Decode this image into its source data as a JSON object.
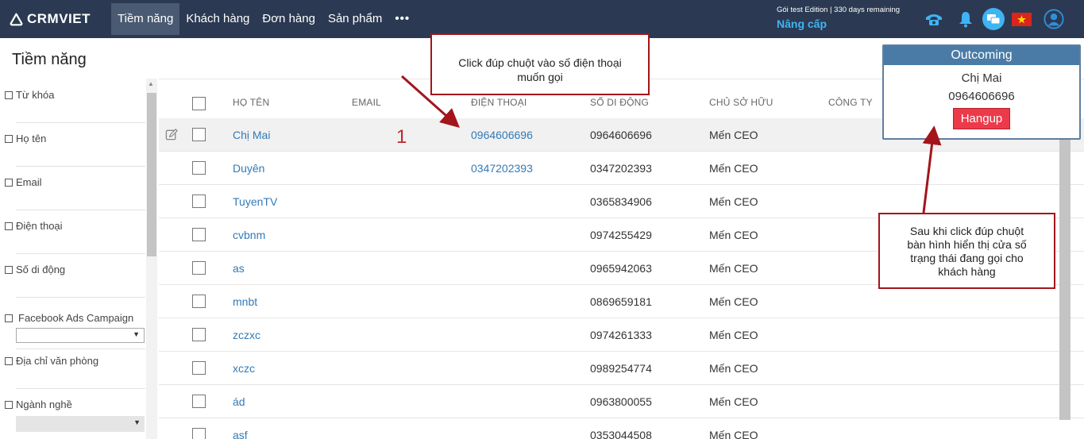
{
  "app": {
    "logo_text": "CRMVIET"
  },
  "nav": {
    "items": [
      "Tiềm năng",
      "Khách hàng",
      "Đơn hàng",
      "Sản phẩm"
    ],
    "more_label": "•••"
  },
  "account": {
    "edition": "Gói test Edition | 330 days remaining",
    "upgrade": "Nâng cấp"
  },
  "top_icons": [
    "phone-icon",
    "bell-icon",
    "chat-icon",
    "vietnam-flag-icon",
    "user-avatar-icon"
  ],
  "page": {
    "title": "Tiềm năng"
  },
  "filters": {
    "items": [
      "Từ khóa",
      "Họ tên",
      "Email",
      "Điện thoại",
      "Số di động",
      "Facebook Ads Campaign",
      "Địa chỉ văn phòng",
      "Ngành nghề"
    ]
  },
  "table": {
    "headers": [
      "HỌ TÊN",
      "EMAIL",
      "ĐIỆN THOẠI",
      "SỐ DI ĐỘNG",
      "CHỦ SỞ HỮU",
      "CÔNG TY"
    ],
    "rows": [
      {
        "name": "Chị Mai",
        "phone": "0964606696",
        "mobile": "0964606696",
        "owner": "Mến CEO"
      },
      {
        "name": "Duyên",
        "phone": "0347202393",
        "mobile": "0347202393",
        "owner": "Mến CEO"
      },
      {
        "name": "TuyenTV",
        "phone": "",
        "mobile": "0365834906",
        "owner": "Mến CEO"
      },
      {
        "name": "cvbnm",
        "phone": "",
        "mobile": "0974255429",
        "owner": "Mến CEO"
      },
      {
        "name": "as",
        "phone": "",
        "mobile": "0965942063",
        "owner": "Mến CEO"
      },
      {
        "name": "mnbt",
        "phone": "",
        "mobile": "0869659181",
        "owner": "Mến CEO"
      },
      {
        "name": "zczxc",
        "phone": "",
        "mobile": "0974261333",
        "owner": "Mến CEO"
      },
      {
        "name": "xczc",
        "phone": "",
        "mobile": "0989254774",
        "owner": "Mến CEO"
      },
      {
        "name": "ád",
        "phone": "",
        "mobile": "0963800055",
        "owner": "Mến CEO"
      },
      {
        "name": "asf",
        "phone": "",
        "mobile": "0353044508",
        "owner": "Mến CEO"
      }
    ]
  },
  "annotations": {
    "step_number": "1",
    "callout_top_line1": "Click đúp chuột vào số điện thoại",
    "callout_top_line2": "muốn gọi",
    "callout_right_line1": "Sau khi click đúp chuột",
    "callout_right_line2": "bàn hình hiển thị cửa số",
    "callout_right_line3": "trạng thái đang gọi cho",
    "callout_right_line4": "khách hàng"
  },
  "popup": {
    "title": "Outcoming",
    "name": "Chị Mai",
    "phone": "0964606696",
    "hangup_label": "Hangup"
  },
  "colors": {
    "topbar": "#2b3a52",
    "link": "#337ab7",
    "upgrade": "#3fb4f3",
    "annotation": "#a4141b",
    "hangup": "#ec3a4a",
    "popup_header": "#4a7ba6"
  }
}
